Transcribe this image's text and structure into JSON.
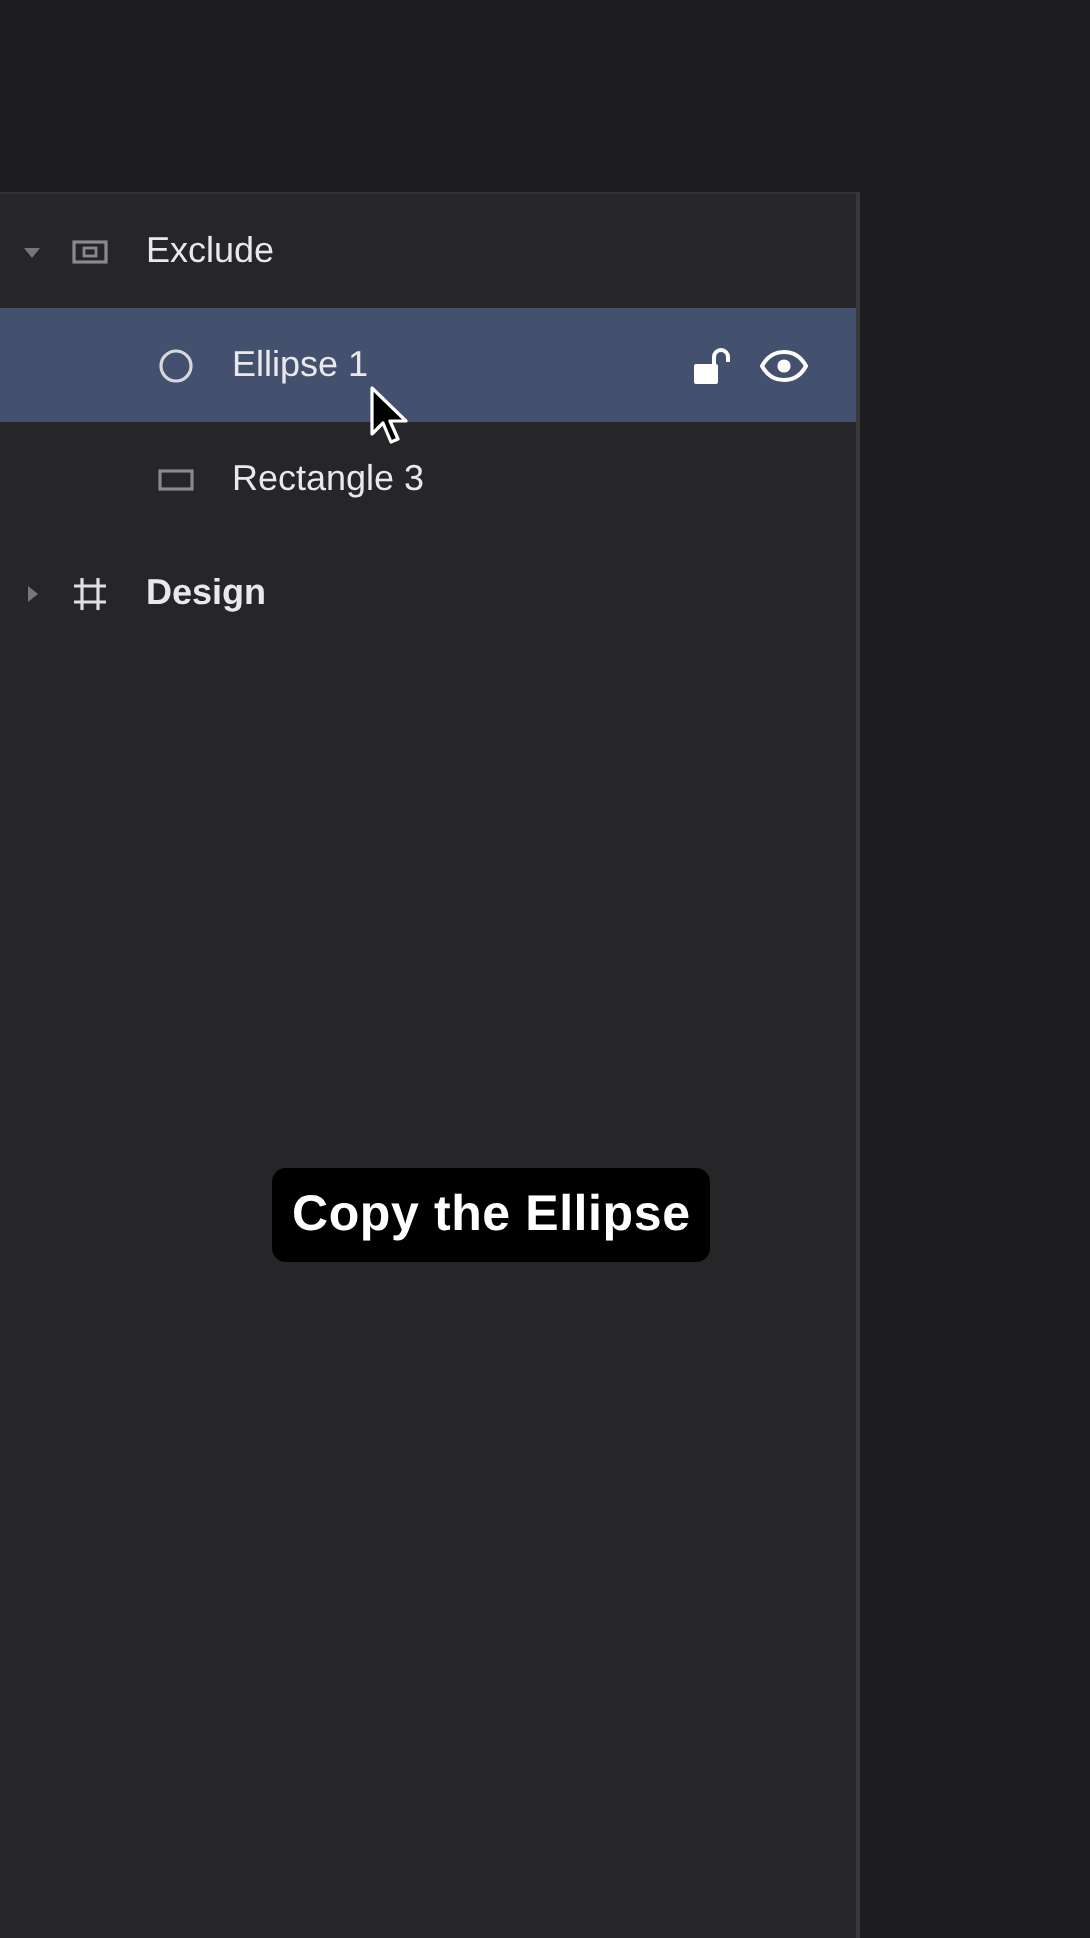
{
  "layers": [
    {
      "kind": "group",
      "name": "Exclude",
      "expanded": true,
      "selected": false,
      "children": [
        {
          "kind": "ellipse",
          "name": "Ellipse 1",
          "selected": true
        },
        {
          "kind": "rectangle",
          "name": "Rectangle 3",
          "selected": false
        }
      ]
    },
    {
      "kind": "frame",
      "name": "Design",
      "expanded": false,
      "selected": false
    }
  ],
  "caption": "Copy the Ellipse"
}
